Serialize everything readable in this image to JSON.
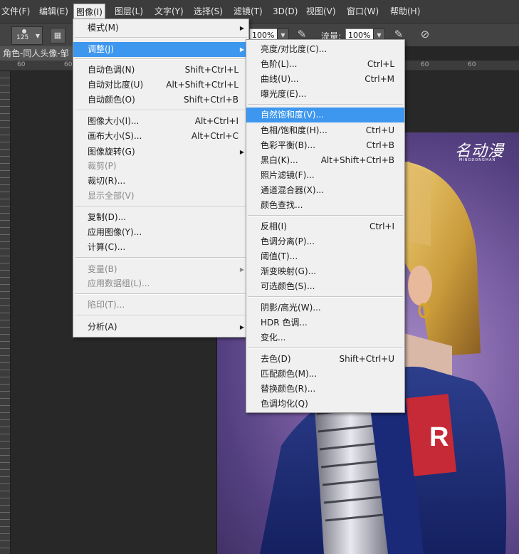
{
  "menubar": {
    "items": [
      {
        "label": "文件(F)"
      },
      {
        "label": "编辑(E)"
      },
      {
        "label": "图像(I)"
      },
      {
        "label": "图层(L)"
      },
      {
        "label": "文字(Y)"
      },
      {
        "label": "选择(S)"
      },
      {
        "label": "滤镜(T)"
      },
      {
        "label": "3D(D)"
      },
      {
        "label": "视图(V)"
      },
      {
        "label": "窗口(W)"
      },
      {
        "label": "帮助(H)"
      }
    ]
  },
  "options_bar": {
    "brush_size": "125",
    "opacity_value": "100%",
    "flow_label": "流量:",
    "flow_value": "100%"
  },
  "document_tab": {
    "title": "角色-同人头像-邹"
  },
  "ruler": {
    "top_labels": [
      "60",
      "60",
      "60",
      "60"
    ]
  },
  "canvas": {
    "watermark": "名动漫",
    "watermark_sub": "MINGDONGMAN"
  },
  "image_menu": {
    "items": [
      {
        "label": "模式(M)",
        "shortcut": "",
        "submenu": true,
        "disabled": false
      },
      {
        "label": "调整(J)",
        "shortcut": "",
        "submenu": true,
        "disabled": false
      },
      {
        "label": "自动色调(N)",
        "shortcut": "Shift+Ctrl+L",
        "submenu": false,
        "disabled": false
      },
      {
        "label": "自动对比度(U)",
        "shortcut": "Alt+Shift+Ctrl+L",
        "submenu": false,
        "disabled": false
      },
      {
        "label": "自动颜色(O)",
        "shortcut": "Shift+Ctrl+B",
        "submenu": false,
        "disabled": false
      },
      {
        "label": "图像大小(I)...",
        "shortcut": "Alt+Ctrl+I",
        "submenu": false,
        "disabled": false
      },
      {
        "label": "画布大小(S)...",
        "shortcut": "Alt+Ctrl+C",
        "submenu": false,
        "disabled": false
      },
      {
        "label": "图像旋转(G)",
        "shortcut": "",
        "submenu": true,
        "disabled": false
      },
      {
        "label": "裁剪(P)",
        "shortcut": "",
        "submenu": false,
        "disabled": true
      },
      {
        "label": "裁切(R)...",
        "shortcut": "",
        "submenu": false,
        "disabled": false
      },
      {
        "label": "显示全部(V)",
        "shortcut": "",
        "submenu": false,
        "disabled": true
      },
      {
        "label": "复制(D)...",
        "shortcut": "",
        "submenu": false,
        "disabled": false
      },
      {
        "label": "应用图像(Y)...",
        "shortcut": "",
        "submenu": false,
        "disabled": false
      },
      {
        "label": "计算(C)...",
        "shortcut": "",
        "submenu": false,
        "disabled": false
      },
      {
        "label": "变量(B)",
        "shortcut": "",
        "submenu": true,
        "disabled": true
      },
      {
        "label": "应用数据组(L)...",
        "shortcut": "",
        "submenu": false,
        "disabled": true
      },
      {
        "label": "陷印(T)...",
        "shortcut": "",
        "submenu": false,
        "disabled": true
      },
      {
        "label": "分析(A)",
        "shortcut": "",
        "submenu": true,
        "disabled": false
      }
    ]
  },
  "adjust_menu": {
    "items": [
      {
        "label": "亮度/对比度(C)...",
        "shortcut": ""
      },
      {
        "label": "色阶(L)...",
        "shortcut": "Ctrl+L"
      },
      {
        "label": "曲线(U)...",
        "shortcut": "Ctrl+M"
      },
      {
        "label": "曝光度(E)...",
        "shortcut": ""
      },
      {
        "label": "自然饱和度(V)...",
        "shortcut": ""
      },
      {
        "label": "色相/饱和度(H)...",
        "shortcut": "Ctrl+U"
      },
      {
        "label": "色彩平衡(B)...",
        "shortcut": "Ctrl+B"
      },
      {
        "label": "黑白(K)...",
        "shortcut": "Alt+Shift+Ctrl+B"
      },
      {
        "label": "照片滤镜(F)...",
        "shortcut": ""
      },
      {
        "label": "通道混合器(X)...",
        "shortcut": ""
      },
      {
        "label": "颜色查找...",
        "shortcut": ""
      },
      {
        "label": "反相(I)",
        "shortcut": "Ctrl+I"
      },
      {
        "label": "色调分离(P)...",
        "shortcut": ""
      },
      {
        "label": "阈值(T)...",
        "shortcut": ""
      },
      {
        "label": "渐变映射(G)...",
        "shortcut": ""
      },
      {
        "label": "可选颜色(S)...",
        "shortcut": ""
      },
      {
        "label": "阴影/高光(W)...",
        "shortcut": ""
      },
      {
        "label": "HDR 色调...",
        "shortcut": ""
      },
      {
        "label": "变化...",
        "shortcut": ""
      },
      {
        "label": "去色(D)",
        "shortcut": "Shift+Ctrl+U"
      },
      {
        "label": "匹配颜色(M)...",
        "shortcut": ""
      },
      {
        "label": "替换颜色(R)...",
        "shortcut": ""
      },
      {
        "label": "色调均化(Q)",
        "shortcut": ""
      }
    ]
  }
}
